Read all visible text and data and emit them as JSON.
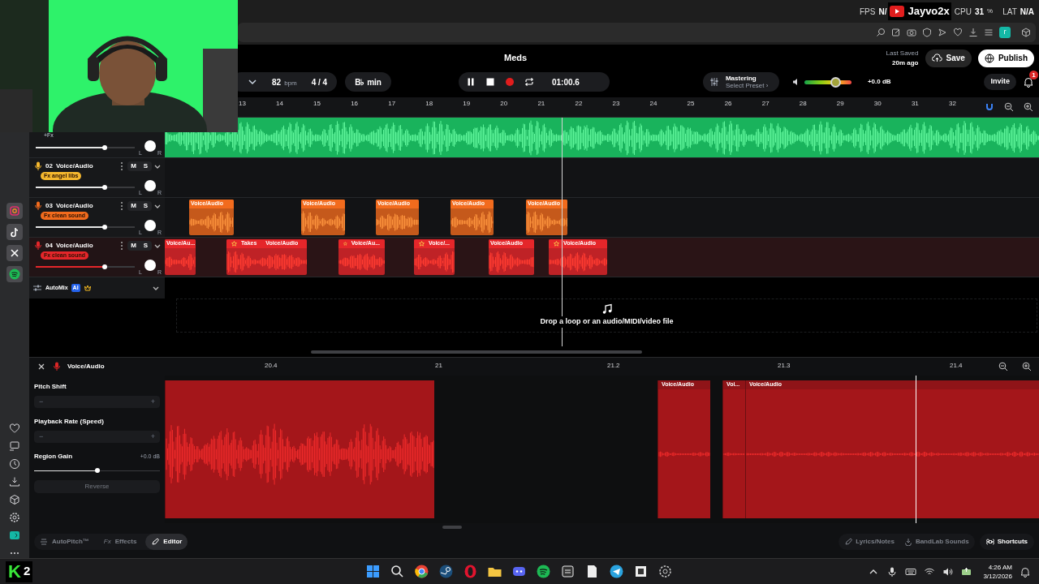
{
  "overlay": {
    "fps_label": "FPS",
    "fps_value": "N/",
    "channel": "Jayvo2x",
    "cpu_label": "CPU",
    "cpu_value": "31",
    "cpu_unit": "%",
    "lat_label": "LAT",
    "lat_value": "N/A"
  },
  "browser": {
    "avatar": "r"
  },
  "header": {
    "title": "Meds",
    "tempo": "82",
    "tempo_unit": "bpm",
    "time_signature": "4 / 4",
    "key": "B♭ min",
    "time": "01:00.6",
    "mastering": "Mastering",
    "preset": "Select Preset ›",
    "volume": {
      "level": 0.66,
      "reading": "+0.0 dB"
    },
    "last_saved_label": "Last Saved",
    "last_saved": "20m ago",
    "save": "Save",
    "publish": "Publish",
    "invite": "Invite",
    "notifications": "1"
  },
  "ruler": [
    "13",
    "14",
    "15",
    "16",
    "17",
    "18",
    "19",
    "20",
    "21",
    "22",
    "23",
    "24",
    "25",
    "26",
    "27",
    "28",
    "29",
    "30",
    "31",
    "32"
  ],
  "tracks": [
    {
      "kind": "partial",
      "fx": "+Fx",
      "color": "#19b35c",
      "selected": false,
      "level": 0.7,
      "pan": {
        "left": "L",
        "right": "R"
      }
    },
    {
      "kind": "audio",
      "number": "02",
      "name": "Voice/Audio",
      "mute": "M",
      "solo": "S",
      "fx": "Fx angel libs",
      "color": "#f5b82e",
      "selected": false,
      "level": 0.7,
      "pan": {
        "left": "L",
        "right": "R"
      }
    },
    {
      "kind": "audio",
      "number": "03",
      "name": "Voice/Audio",
      "mute": "M",
      "solo": "S",
      "fx": "Fx clean sound",
      "color": "#f26b1d",
      "selected": false,
      "level": 0.7,
      "pan": {
        "left": "L",
        "right": "R"
      },
      "clips": [
        {
          "label": "Voice/Audio",
          "starred": false
        },
        {
          "label": "Voice/Audio",
          "starred": false
        },
        {
          "label": "Voice/Audio",
          "starred": false
        },
        {
          "label": "Voice/Audio",
          "starred": false
        },
        {
          "label": "Voice/Audio",
          "starred": false
        }
      ]
    },
    {
      "kind": "audio",
      "number": "04",
      "name": "Voice/Audio",
      "mute": "M",
      "solo": "S",
      "fx": "Fx clean sound",
      "color": "#e5262a",
      "selected": true,
      "level": 0.7,
      "pan": {
        "left": "L",
        "right": "R"
      },
      "clips": [
        {
          "label": "Voice/Au...",
          "starred": false
        },
        {
          "label": "Voice/Audio",
          "starred": true,
          "takes": "Takes"
        },
        {
          "label": "Voice/Au...",
          "starred": true
        },
        {
          "label": "Voice/...",
          "starred": true
        },
        {
          "label": "Voice/Audio",
          "starred": false
        },
        {
          "label": "Voice/Audio",
          "starred": true
        }
      ]
    }
  ],
  "automix": {
    "label": "AutoMix",
    "badge": "AI"
  },
  "drop_zone": "Drop a loop or an audio/MIDI/video file",
  "editor": {
    "title": "Voice/Audio",
    "ruler": [
      "20.4",
      "21",
      "21.2",
      "21.3",
      "21.4"
    ],
    "params": [
      {
        "kind": "stepper",
        "label": "Pitch Shift",
        "minus": "−",
        "plus": "+"
      },
      {
        "kind": "stepper",
        "label": "Playback Rate (Speed)",
        "minus": "−",
        "plus": "+"
      },
      {
        "kind": "slider",
        "label": "Region Gain",
        "reading": "+0.0 dB",
        "level": 0.5
      },
      {
        "kind": "button",
        "label": "Reverse",
        "disabled": true
      }
    ],
    "regions": [
      {
        "kind": "plain"
      },
      {
        "kind": "titled",
        "label": "Voice/Audio"
      },
      {
        "kind": "titled",
        "label": "Voi..."
      },
      {
        "kind": "titled",
        "label": "Voice/Audio"
      }
    ]
  },
  "bottom_tabs": [
    {
      "label": "AutoPitch™",
      "selected": false
    },
    {
      "label": "Effects",
      "glyph": "Fx",
      "selected": false
    },
    {
      "label": "Editor",
      "selected": true
    }
  ],
  "bottom_links": [
    {
      "label": "Lyrics/Notes"
    },
    {
      "label": "BandLab Sounds"
    }
  ],
  "shortcuts": "Shortcuts",
  "taskbar": {
    "logo": "K",
    "badge": "2",
    "time": "4:26 AM",
    "date": "3/12/2026"
  }
}
